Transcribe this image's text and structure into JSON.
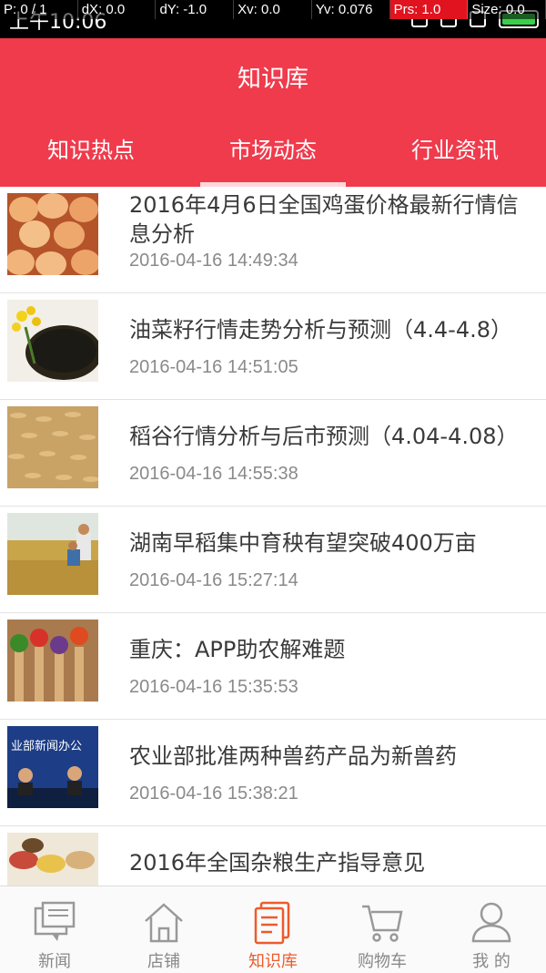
{
  "status": {
    "time": "上午10:06"
  },
  "debug": [
    "P: 0 / 1",
    "dX: 0.0",
    "dY: -1.0",
    "Xv: 0.0",
    "Yv: 0.076",
    "Prs: 1.0",
    "Size: 0.0"
  ],
  "header": {
    "title": "知识库",
    "tabs": [
      {
        "label": "知识热点"
      },
      {
        "label": "市场动态"
      },
      {
        "label": "行业资讯"
      }
    ]
  },
  "articles": [
    {
      "title": "2016年4月6日全国鸡蛋价格最新行情信息分析",
      "date": "2016-04-16 14:49:34"
    },
    {
      "title": "油菜籽行情走势分析与预测（4.4-4.8）",
      "date": "2016-04-16 14:51:05"
    },
    {
      "title": "稻谷行情分析与后市预测（4.04-4.08）",
      "date": "2016-04-16 14:55:38"
    },
    {
      "title": "湖南早稻集中育秧有望突破400万亩",
      "date": "2016-04-16 15:27:14"
    },
    {
      "title": "重庆：APP助农解难题",
      "date": "2016-04-16 15:35:53"
    },
    {
      "title": "农业部批准两种兽药产品为新兽药",
      "date": "2016-04-16 15:38:21",
      "thumb_text": "业部新闻办公"
    },
    {
      "title": "2016年全国杂粮生产指导意见",
      "date": ""
    }
  ],
  "nav": [
    {
      "label": "新闻",
      "icon": "news-chat-icon"
    },
    {
      "label": "店铺",
      "icon": "home-store-icon"
    },
    {
      "label": "知识库",
      "icon": "document-icon"
    },
    {
      "label": "购物车",
      "icon": "cart-icon"
    },
    {
      "label": "我 的",
      "icon": "user-icon"
    }
  ],
  "colors": {
    "brand": "#ef3b4c",
    "nav_active": "#ef5a2a"
  }
}
